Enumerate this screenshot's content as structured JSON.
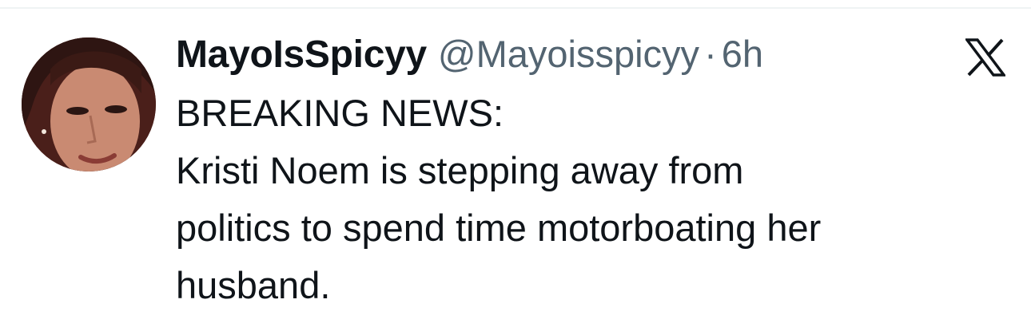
{
  "tweet": {
    "author": {
      "display_name": "MayoIsSpicyy",
      "handle": "@Mayoisspicyy"
    },
    "separator": "·",
    "time_ago": "6h",
    "text_lines": [
      "BREAKING NEWS:",
      "Kristi Noem is stepping away from",
      "politics to spend time motorboating her",
      "husband."
    ]
  },
  "icons": {
    "brand": "x-logo-icon",
    "avatar": "profile-photo"
  },
  "colors": {
    "text_primary": "#0f1419",
    "text_secondary": "#536471",
    "background": "#ffffff"
  }
}
